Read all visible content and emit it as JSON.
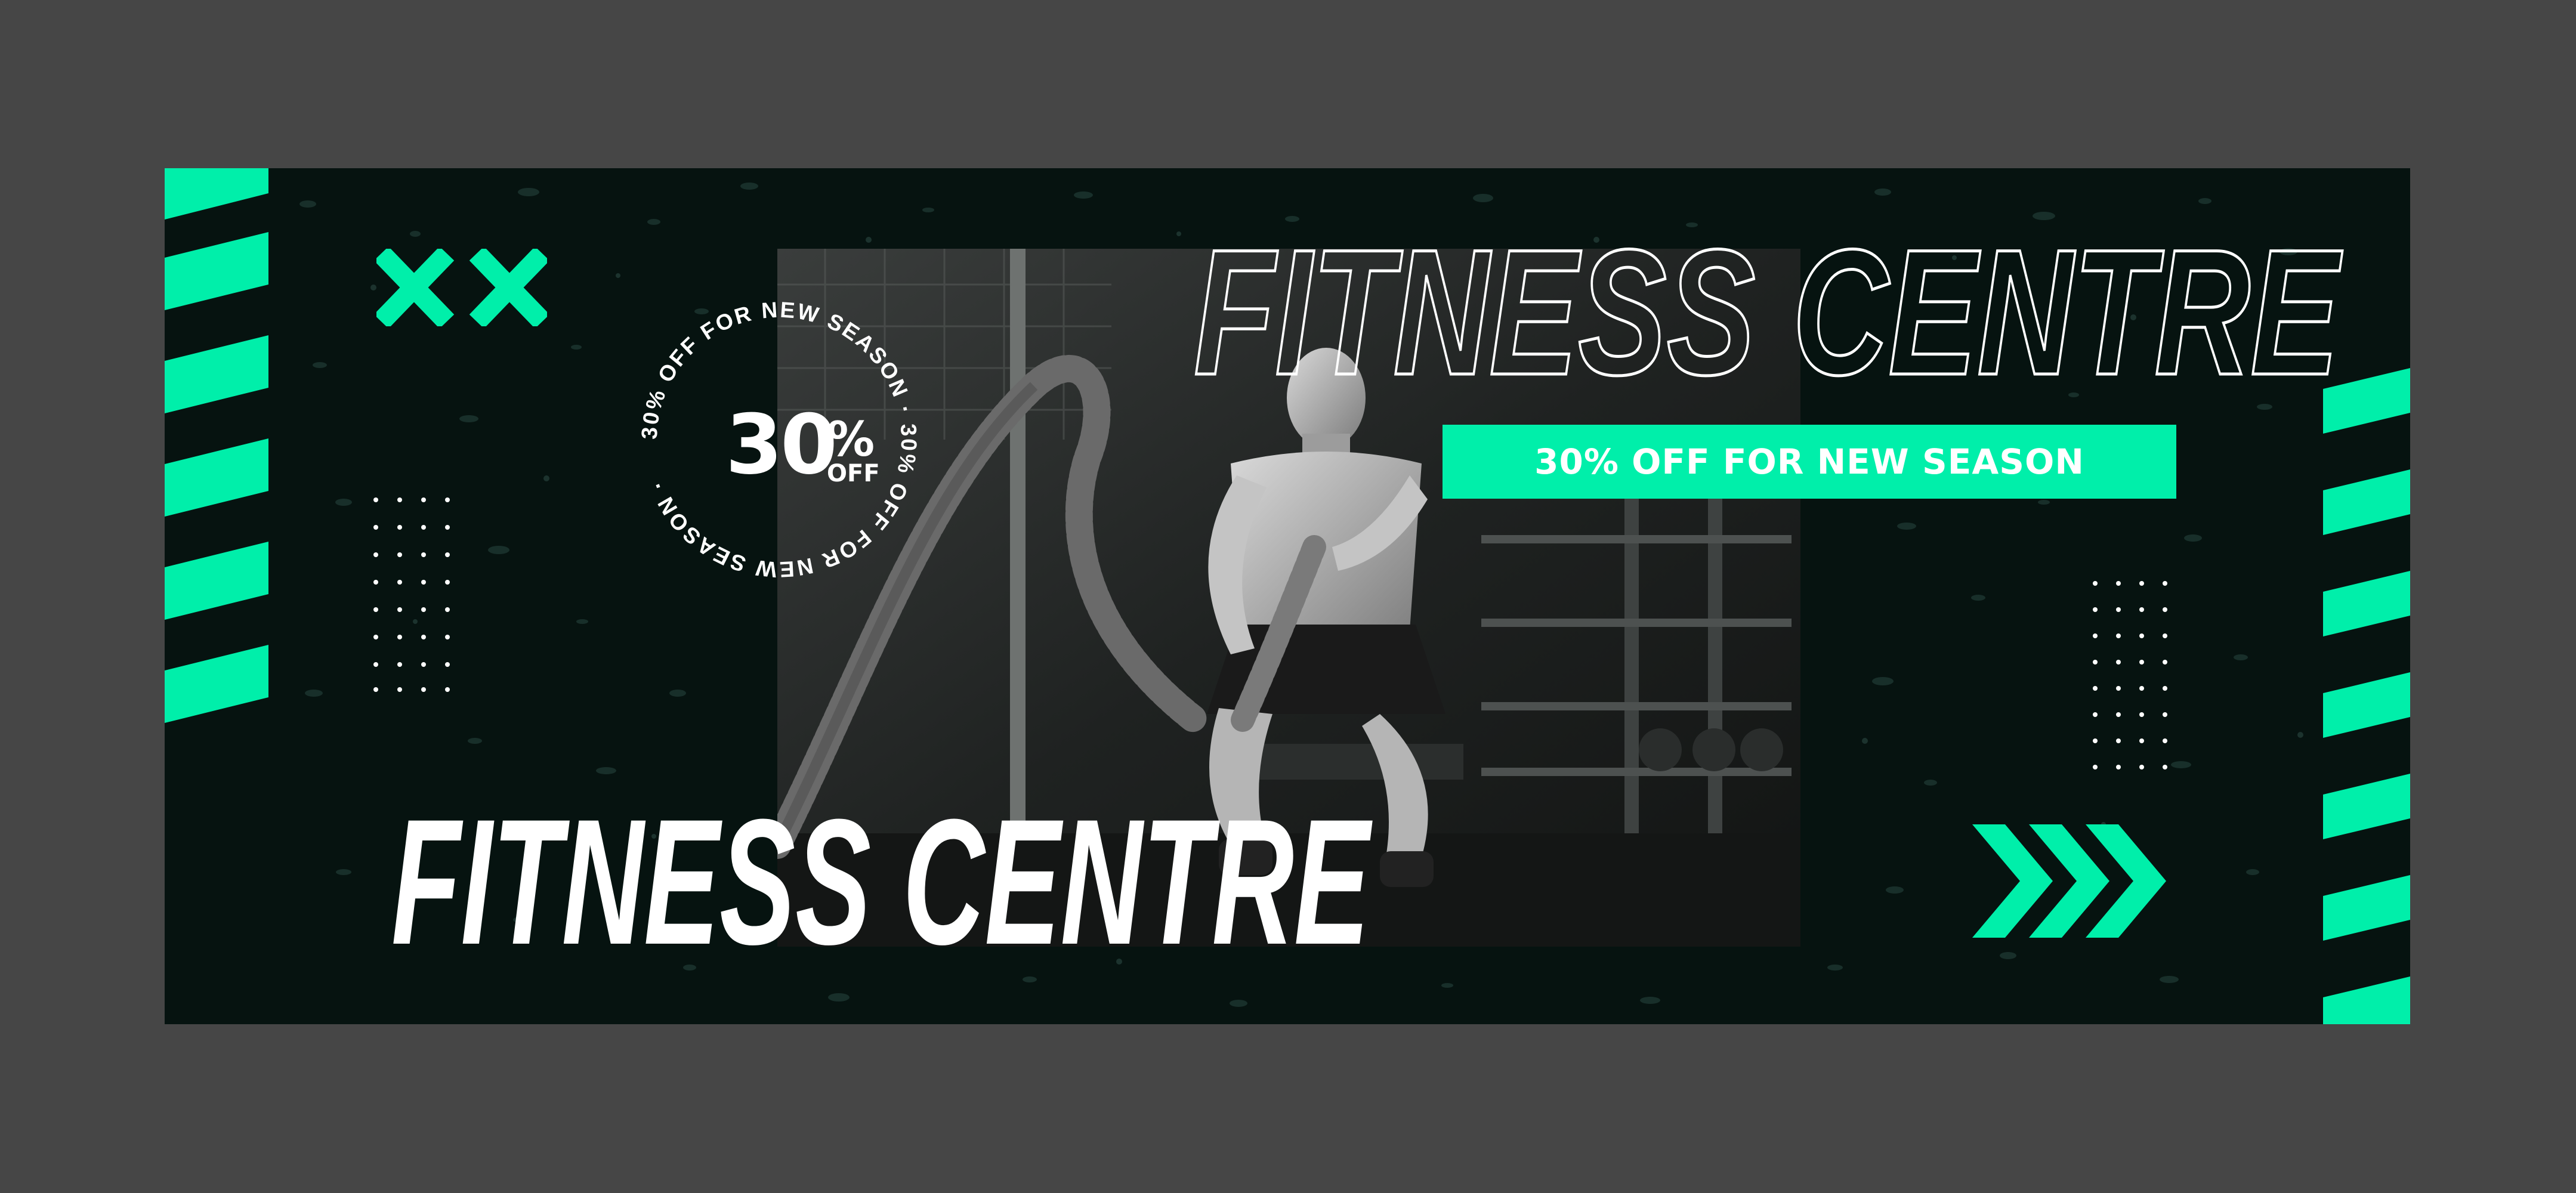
{
  "banner": {
    "headline_outline": "FITNESS CENTRE",
    "promo_bar_text": "30% OFF FOR NEW SEASON",
    "headline_solid": "FITNESS CENTRE",
    "badge": {
      "circle_text": "30% OFF FOR NEW SEASON · 30% OFF FOR NEW SEASON ·",
      "amount": "30",
      "percent": "%",
      "off": "OFF"
    },
    "photo_subject": "man-training-with-battle-ropes-photo",
    "colors": {
      "accent": "#00efaa",
      "background": "#061310",
      "frame": "#464646",
      "text": "#ffffff"
    }
  }
}
